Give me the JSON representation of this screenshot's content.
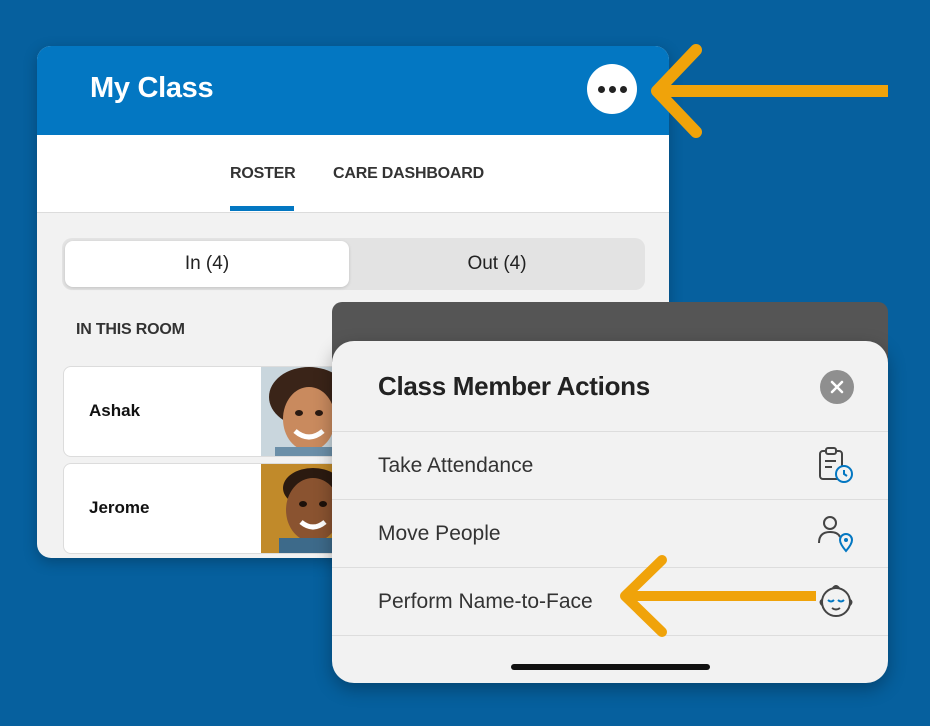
{
  "card": {
    "title": "My Class",
    "tabs": [
      {
        "label": "ROSTER",
        "active": true
      },
      {
        "label": "CARE DASHBOARD",
        "active": false
      }
    ],
    "segments": [
      {
        "label": "In (4)",
        "selected": true
      },
      {
        "label": "Out (4)",
        "selected": false
      }
    ],
    "section_label": "IN THIS ROOM",
    "members": [
      {
        "name": "Ashak"
      },
      {
        "name": "Jerome"
      }
    ]
  },
  "sheet": {
    "title": "Class Member Actions",
    "actions": [
      {
        "label": "Take Attendance",
        "icon": "clipboard-clock-icon"
      },
      {
        "label": "Move People",
        "icon": "person-location-icon"
      },
      {
        "label": "Perform Name-to-Face",
        "icon": "baby-face-icon"
      }
    ]
  },
  "colors": {
    "background": "#06609e",
    "header": "#0377c2",
    "accent_arrow": "#f0a30a",
    "icon_accent": "#0377c2"
  }
}
